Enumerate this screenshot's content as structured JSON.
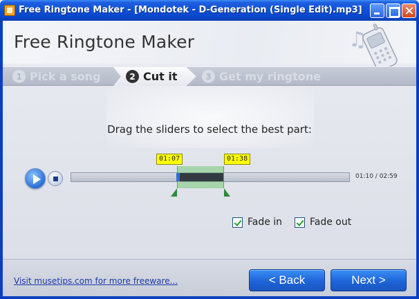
{
  "window": {
    "title": "Free Ringtone Maker - [Mondotek - D-Generation (Single Edit).mp3]"
  },
  "header": {
    "app_name": "Free Ringtone Maker"
  },
  "steps": [
    {
      "number": "1",
      "label": "Pick a song",
      "state": "done"
    },
    {
      "number": "2",
      "label": "Cut it",
      "state": "active"
    },
    {
      "number": "3",
      "label": "Get my ringtone",
      "state": "pending"
    }
  ],
  "main": {
    "instruction": "Drag the sliders to select the best part:",
    "selection_start": "01:07",
    "selection_end": "01:38",
    "time_readout": "01:10 / 02:59",
    "fade_in_label": "Fade in",
    "fade_in_checked": true,
    "fade_out_label": "Fade out",
    "fade_out_checked": true
  },
  "footer": {
    "link_text": "Visit musetips.com for more freeware...",
    "back_label": "< Back",
    "next_label": "Next >"
  },
  "colors": {
    "titlebar": "#0c4fd6",
    "accent": "#1e64d8",
    "selection": "#78c878",
    "marker": "#ffff00"
  }
}
